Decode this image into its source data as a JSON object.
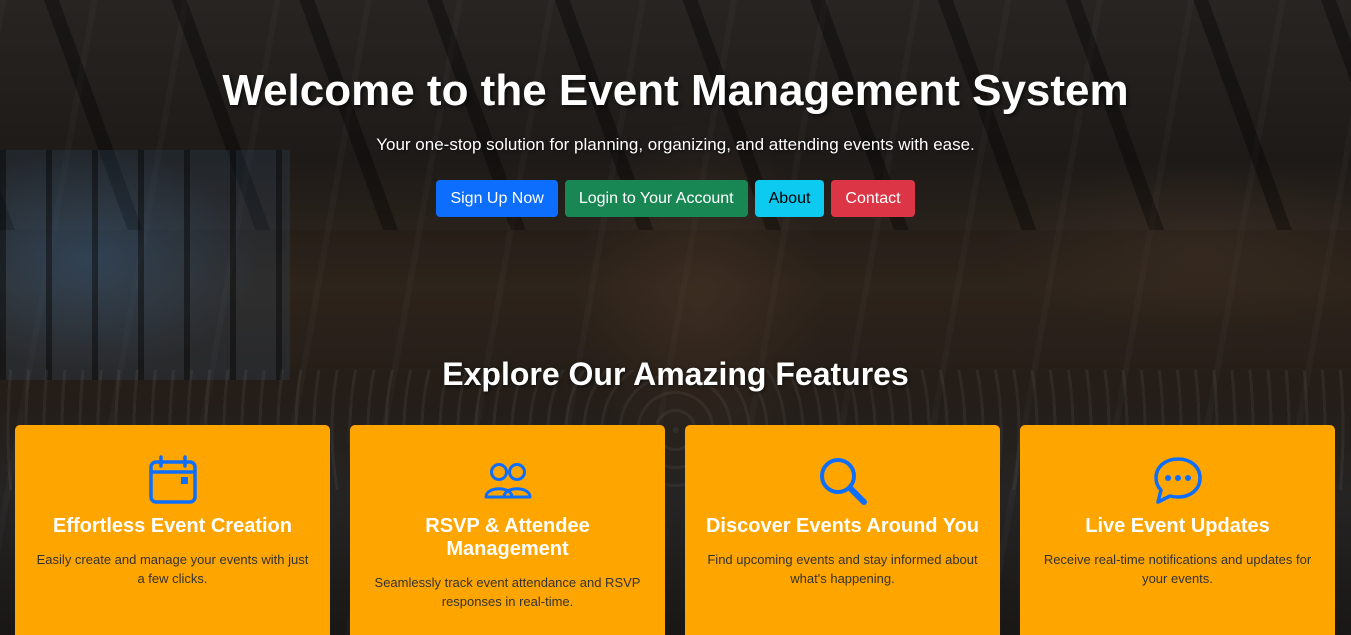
{
  "hero": {
    "title": "Welcome to the Event Management System",
    "subtitle": "Your one-stop solution for planning, organizing, and attending events with ease."
  },
  "buttons": {
    "signup": "Sign Up Now",
    "login": "Login to Your Account",
    "about": "About",
    "contact": "Contact"
  },
  "features": {
    "heading": "Explore Our Amazing Features",
    "items": [
      {
        "icon": "calendar-icon",
        "title": "Effortless Event Creation",
        "text": "Easily create and manage your events with just a few clicks."
      },
      {
        "icon": "people-icon",
        "title": "RSVP & Attendee Management",
        "text": "Seamlessly track event attendance and RSVP responses in real-time."
      },
      {
        "icon": "search-icon",
        "title": "Discover Events Around You",
        "text": "Find upcoming events and stay informed about what's happening."
      },
      {
        "icon": "chat-dots-icon",
        "title": "Live Event Updates",
        "text": "Receive real-time notifications and updates for your events."
      }
    ]
  },
  "colors": {
    "primary": "#0d6efd",
    "success": "#198754",
    "info": "#0dcaf0",
    "danger": "#dc3545",
    "card": "#ffa500",
    "icon": "#0d6efd"
  }
}
